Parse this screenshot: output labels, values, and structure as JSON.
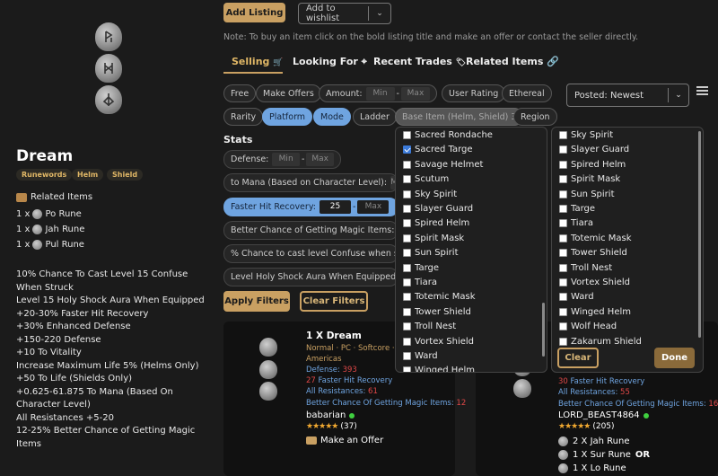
{
  "item": {
    "name": "Dream",
    "tags": [
      "Runewords",
      "Helm",
      "Shield"
    ],
    "related_title": "Related Items",
    "runes": [
      {
        "qty": "1 x",
        "name": "Po Rune"
      },
      {
        "qty": "1 x",
        "name": "Jah Rune"
      },
      {
        "qty": "1 x",
        "name": "Pul Rune"
      }
    ],
    "stats": [
      "10% Chance To Cast Level 15 Confuse When Struck",
      "Level 15 Holy Shock Aura When Equipped",
      "+20-30% Faster Hit Recovery",
      "+30% Enhanced Defense",
      "+150-220 Defense",
      "+10 To Vitality",
      "Increase Maximum Life 5% (Helms Only)",
      "+50 To Life (Shields Only)",
      "+0.625-61.875 To Mana (Based On Character Level)",
      "All Resistances +5-20",
      "12-25% Better Chance of Getting Magic Items"
    ]
  },
  "toolbar": {
    "add_listing": "Add Listing",
    "wishlist": "Add to wishlist",
    "note": "Note: To buy an item click on the bold listing title and make an offer or contact the seller directly."
  },
  "tabs": {
    "selling": "Selling",
    "looking_for": "Looking For",
    "recent_trades": "Recent Trades",
    "related_items": "Related Items"
  },
  "filters": {
    "free": "Free",
    "make_offers": "Make Offers",
    "amount": "Amount:",
    "min": "Min",
    "max": "Max",
    "user_rating": "User Rating",
    "ethereal": "Ethereal",
    "rarity": "Rarity",
    "platform": "Platform",
    "mode": "Mode",
    "ladder": "Ladder",
    "base_item": "Base Item (Helm, Shield) 3",
    "region": "Region",
    "sort": "Posted: Newest",
    "stats_title": "Stats",
    "stat_rows": [
      {
        "label": "Defense:"
      },
      {
        "label": "to Mana (Based on Character Level):"
      },
      {
        "label": "Faster Hit Recovery:",
        "value": "25"
      },
      {
        "label": "Better Chance of Getting Magic Items:"
      },
      {
        "label": "% Chance to cast level Confuse when struck:"
      },
      {
        "label": "Level Holy Shock Aura When Equipped:"
      }
    ],
    "apply": "Apply Filters",
    "clear": "Clear Filters"
  },
  "base_dropdown": {
    "left_items": [
      "Sacred Rondache",
      "Sacred Targe",
      "Savage Helmet",
      "Scutum",
      "Sky Spirit",
      "Slayer Guard",
      "Spired Helm",
      "Spirit Mask",
      "Sun Spirit",
      "Targe",
      "Tiara",
      "Totemic Mask",
      "Tower Shield",
      "Troll Nest",
      "Vortex Shield",
      "Ward",
      "Winged Helm"
    ],
    "left_checked": "Sacred Targe",
    "right_items": [
      "Sky Spirit",
      "Slayer Guard",
      "Spired Helm",
      "Spirit Mask",
      "Sun Spirit",
      "Targe",
      "Tiara",
      "Totemic Mask",
      "Tower Shield",
      "Troll Nest",
      "Vortex Shield",
      "Ward",
      "Winged Helm",
      "Wolf Head",
      "Zakarum Shield"
    ],
    "clear": "Clear",
    "done": "Done"
  },
  "listings": [
    {
      "title": "1 X Dream",
      "meta": "Normal · PC · Softcore · Sac",
      "region": "Americas",
      "defense_label": "Defense:",
      "defense": "393",
      "fhr": "27",
      "fhr_label": "Faster Hit Recovery",
      "res_label": "All Resistances:",
      "res": "61",
      "mf_label": "Better Chance Of Getting Magic Items:",
      "mf": "12",
      "seller": "babarian",
      "rating": "(37)",
      "offer": "Make an Offer"
    },
    {
      "fhr": "30",
      "fhr_label": "Faster Hit Recovery",
      "res_label": "All Resistances:",
      "res": "55",
      "mf_label": "Better Chance Of Getting Magic Items:",
      "mf": "16",
      "seller": "LORD_BEAST4864",
      "rating": "(205)",
      "price": [
        {
          "text": "2 X Jah Rune",
          "suffix": ""
        },
        {
          "text": "1 X Sur Rune",
          "suffix": "OR"
        },
        {
          "text": "1 X Lo Rune",
          "suffix": ""
        }
      ]
    }
  ],
  "colors": {
    "gold": "#c9a062",
    "blue": "#6fa4e0",
    "red": "#e04848",
    "green": "#3fcf3f",
    "bg": "#1b1b1b"
  }
}
